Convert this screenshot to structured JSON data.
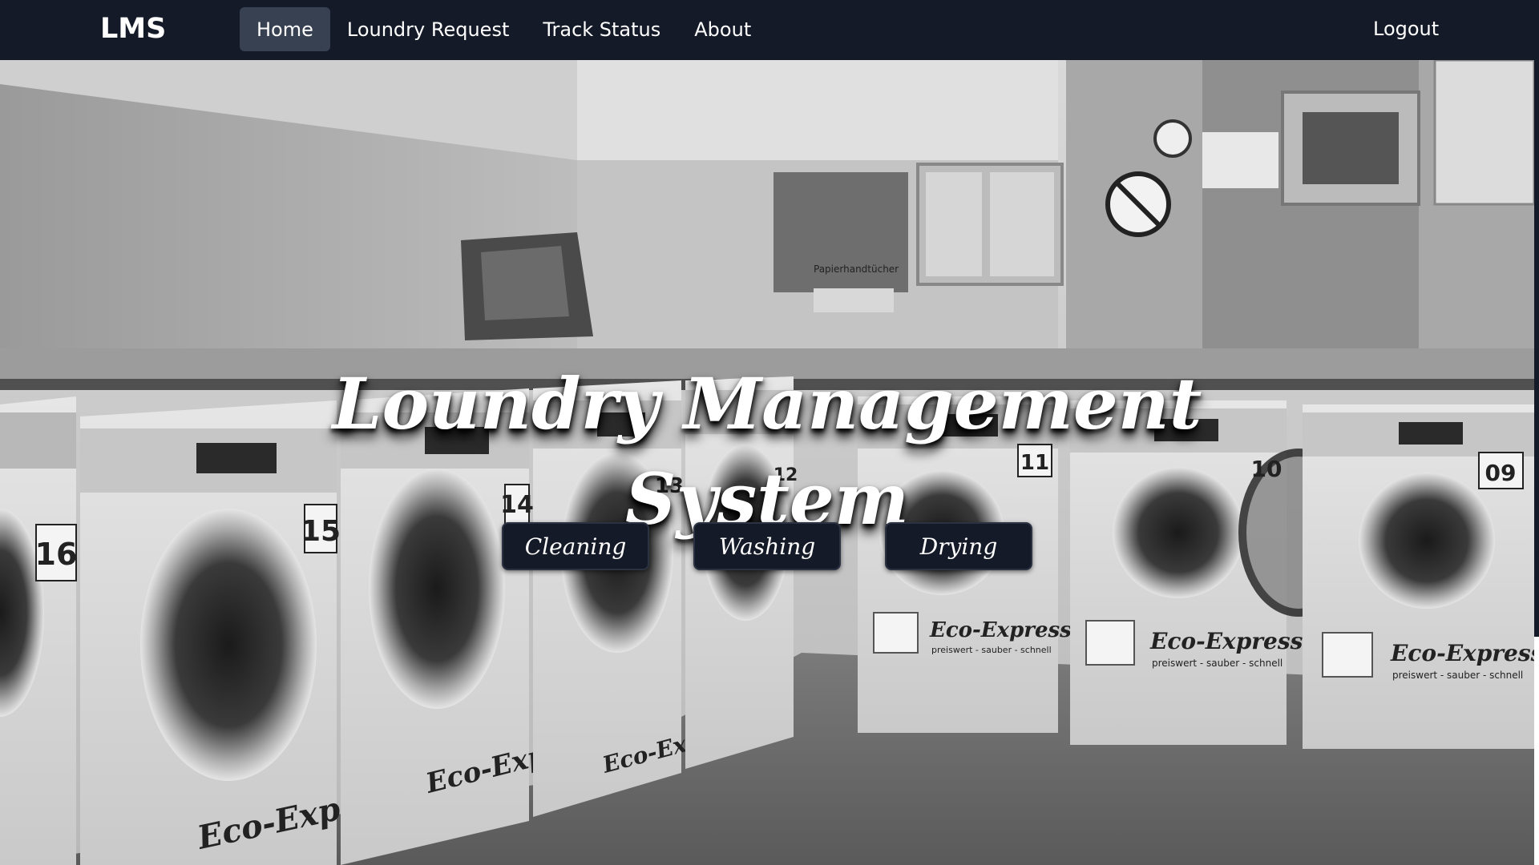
{
  "nav": {
    "brand": "LMS",
    "links": [
      {
        "label": "Home",
        "active": true
      },
      {
        "label": "Loundry Request",
        "active": false
      },
      {
        "label": "Track Status",
        "active": false
      },
      {
        "label": "About",
        "active": false
      }
    ],
    "logout": "Logout"
  },
  "hero": {
    "title_line1": "Loundry Management",
    "title_line2": "System",
    "buttons": [
      "Cleaning",
      "Washing",
      "Drying"
    ]
  },
  "scene": {
    "machine_numbers": [
      "16",
      "15",
      "14",
      "13",
      "12",
      "11",
      "10",
      "09"
    ],
    "machine_brand": "Eco-Express",
    "machine_tagline": "preiswert - sauber - schnell",
    "dispenser_label": "Papierhandtücher"
  },
  "colors": {
    "navbar": "#141a27",
    "active_link": "#374151",
    "text": "#ffffff",
    "button_bg": "#141a27"
  }
}
